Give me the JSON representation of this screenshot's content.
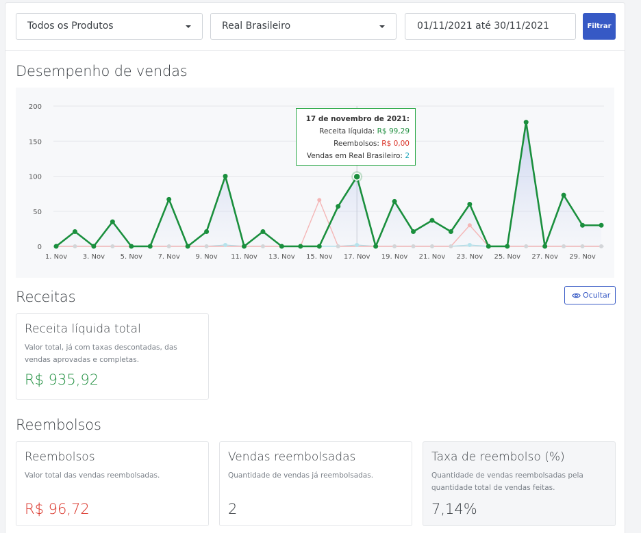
{
  "filters": {
    "product_select": "Todos os Produtos",
    "currency_select": "Real Brasileiro",
    "date_range": "01/11/2021 até 30/11/2021",
    "filter_button": "Filtrar"
  },
  "performance": {
    "title": "Desempenho de vendas",
    "tooltip": {
      "date": "17 de novembro de 2021:",
      "net_label": "Receita líquida:",
      "net_value": "R$ 99,29",
      "refunds_label": "Reembolsos:",
      "refunds_value": "R$ 0,00",
      "sales_label": "Vendas em Real Brasileiro:",
      "sales_value": "2"
    }
  },
  "chart_data": {
    "type": "line",
    "x": [
      "1. Nov",
      "2. Nov",
      "3. Nov",
      "4. Nov",
      "5. Nov",
      "6. Nov",
      "7. Nov",
      "8. Nov",
      "9. Nov",
      "10. Nov",
      "11. Nov",
      "12. Nov",
      "13. Nov",
      "14. Nov",
      "15. Nov",
      "16. Nov",
      "17. Nov",
      "18. Nov",
      "19. Nov",
      "20. Nov",
      "21. Nov",
      "22. Nov",
      "23. Nov",
      "24. Nov",
      "25. Nov",
      "26. Nov",
      "27. Nov",
      "28. Nov",
      "29. Nov",
      "30. Nov"
    ],
    "tick_labels": [
      "1. Nov",
      "3. Nov",
      "5. Nov",
      "7. Nov",
      "9. Nov",
      "11. Nov",
      "13. Nov",
      "15. Nov",
      "17. Nov",
      "19. Nov",
      "21. Nov",
      "23. Nov",
      "25. Nov",
      "27. Nov",
      "29. Nov"
    ],
    "ylim": [
      0,
      200
    ],
    "yticks": [
      "0",
      "50",
      "100",
      "150",
      "200"
    ],
    "grid": true,
    "series": [
      {
        "key": "net",
        "color": "#1a8f3d",
        "values": [
          0,
          21,
          0,
          35,
          0,
          0,
          67,
          0,
          21,
          100,
          0,
          21,
          0,
          0,
          0,
          57,
          99.29,
          0,
          64,
          21,
          37,
          21,
          60,
          0,
          0,
          177,
          0,
          73,
          30,
          30
        ]
      },
      {
        "key": "refunds",
        "color": "#f4b6b6",
        "values": [
          0,
          0,
          0,
          0,
          0,
          0,
          0,
          0,
          0,
          0,
          0,
          0,
          0,
          0,
          66,
          0,
          0,
          0,
          0,
          0,
          0,
          0,
          30,
          0,
          0,
          0,
          0,
          0,
          0,
          0
        ]
      },
      {
        "key": "sales",
        "color": "#a8dbe6",
        "values": [
          0,
          0,
          0,
          0,
          0,
          0,
          0,
          0,
          0,
          2,
          0,
          0,
          0,
          0,
          0,
          0,
          2,
          0,
          0,
          0,
          0,
          0,
          2,
          0,
          0,
          0,
          0,
          0,
          0,
          0
        ]
      }
    ]
  },
  "revenue": {
    "title": "Receitas",
    "hide_button": "Ocultar",
    "card": {
      "title": "Receita líquida total",
      "desc": "Valor total, já com taxas descontadas, das vendas aprovadas e completas.",
      "value": "R$ 935,92"
    }
  },
  "refunds": {
    "title": "Reembolsos",
    "cards": [
      {
        "title": "Reembolsos",
        "desc": "Valor total das vendas reembolsadas.",
        "value": "R$ 96,72"
      },
      {
        "title": "Vendas reembolsadas",
        "desc": "Quantidade de vendas já reembolsadas.",
        "value": "2"
      },
      {
        "title": "Taxa de reembolso (%)",
        "desc": "Quantidade de vendas reembolsadas pela quantidade total de vendas feitas.",
        "value": "7,14%"
      }
    ]
  }
}
